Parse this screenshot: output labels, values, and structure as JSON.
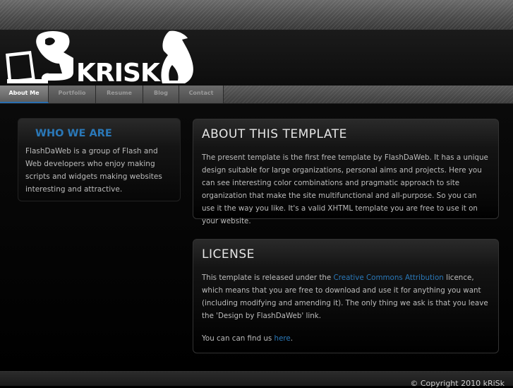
{
  "logo": {
    "text": "KRISK"
  },
  "nav": [
    {
      "label": "About Me",
      "active": true
    },
    {
      "label": "Portfolio",
      "active": false
    },
    {
      "label": "Resume",
      "active": false
    },
    {
      "label": "Blog",
      "active": false
    },
    {
      "label": "Contact",
      "active": false
    }
  ],
  "sidebar": {
    "title": "WHO WE ARE",
    "text": "FlashDaWeb is a group of Flash and Web developers who enjoy making scripts and widgets making websites interesting and attractive."
  },
  "about": {
    "title": "ABOUT THIS TEMPLATE",
    "text": "The present template is the first free template by FlashDaWeb. It has a unique design suitable for large organizations, personal aims and projects. Here you can see interesting color combinations and pragmatic approach to site organization that make the site multifunctional and all-purpose. So you can use it the way you like. It's a valid XHTML template you are free to use it on your website."
  },
  "license": {
    "title": "LICENSE",
    "text_before": "This template is released under the ",
    "link_text": "Creative Commons Attribution",
    "text_after": " licence, which means that you are free to download and use it for anything you want (including modifying and amending it). The only thing we ask is that you leave the 'Design by FlashDaWeb' link.",
    "find_before": "You can can find us ",
    "find_link": "here",
    "find_after": "."
  },
  "footer": {
    "copyright": "© Copyright 2010 kRiSk"
  },
  "colors": {
    "accent": "#2a78b8",
    "background": "#000000"
  }
}
